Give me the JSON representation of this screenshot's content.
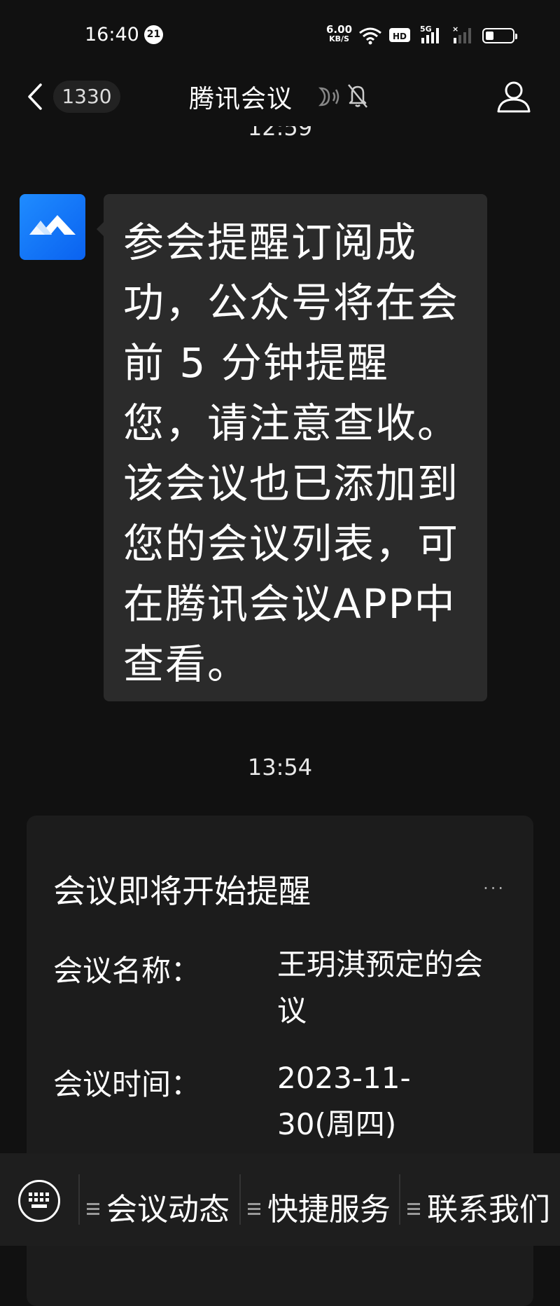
{
  "status_bar": {
    "time": "16:40",
    "notification_count": "21",
    "net_speed_value": "6.00",
    "net_speed_unit": "KB/S",
    "hd_label": "HD",
    "network_label": "5G",
    "battery_level": 0.3
  },
  "header": {
    "unread_count": "1330",
    "title": "腾讯会议"
  },
  "chat": {
    "timestamp_top": "12:59",
    "message_text": "参会提醒订阅成功，公众号将在会前 5 分钟提醒您，请注意查收。该会议也已添加到您的会议列表，可在腾讯会议APP中查看。",
    "timestamp_mid": "13:54"
  },
  "card": {
    "title": "会议即将开始提醒",
    "more_label": "···",
    "rows": [
      {
        "label": "会议名称：",
        "value": "王玥淇预定的会议"
      },
      {
        "label": "会议时间：",
        "value": "2023-11-30(周四)"
      }
    ]
  },
  "bottom_menu": {
    "items": [
      "会议动态",
      "快捷服务",
      "联系我们"
    ]
  },
  "colors": {
    "background": "#111111",
    "bubble": "#2b2b2b",
    "brand_blue": "#1a7cff"
  }
}
